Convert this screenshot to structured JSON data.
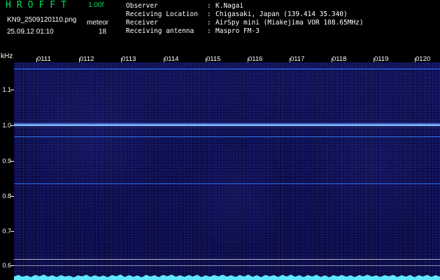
{
  "header": {
    "app_title": "HROFFT",
    "version": "1.00f",
    "filename": "KN9_2509120110.png",
    "datetime": "25.09.12 01:10",
    "meteor_label": "meteor",
    "meteor_count": "18"
  },
  "station_info": [
    {
      "label": "Observer",
      "separator": ":",
      "value": "K.Nagai"
    },
    {
      "label": "Receiving Location",
      "separator": ":",
      "value": "Chigasaki, Japan (139.414 35.340)"
    },
    {
      "label": "Receiver",
      "separator": ":",
      "value": "AirSpy mini (Miakejima VOR 108.65MHz)"
    },
    {
      "label": "Receiving antenna",
      "separator": ":",
      "value": "Maspro FM-3"
    }
  ],
  "axis": {
    "unit": "kHz",
    "y_ticks": [
      "1.1",
      "1.0",
      "0.9",
      "0.8",
      "0.7",
      "0.6"
    ],
    "x_ticks": [
      "0111",
      "0112",
      "0113",
      "0114",
      "0115",
      "0116",
      "0117",
      "0118",
      "0119",
      "0120"
    ]
  },
  "colors": {
    "background": "#000000",
    "title_green": "#00e05a",
    "waterfall_blue": "#10104f",
    "signal_blue": "#2f7cff",
    "spectrum_cyan": "#5ee7ff"
  }
}
